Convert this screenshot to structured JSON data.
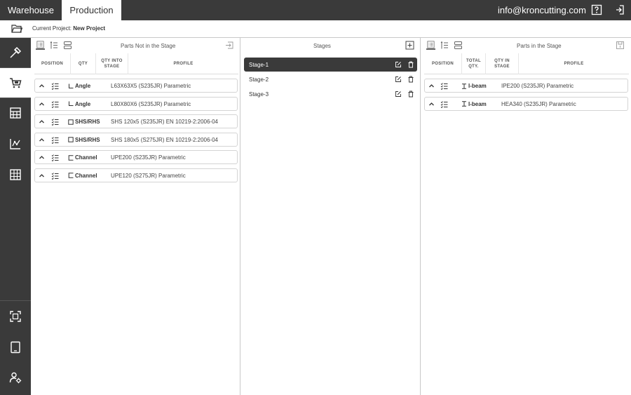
{
  "topbar": {
    "tabs": [
      {
        "label": "Warehouse"
      },
      {
        "label": "Production"
      }
    ],
    "user_email": "info@kroncutting.com",
    "icons": [
      "help-icon",
      "logout-icon"
    ]
  },
  "project": {
    "label": "Current Project:",
    "name": "New Project"
  },
  "sidenav": {
    "items": [
      "cutting-tools-icon",
      "cart-icon",
      "calculator-icon",
      "analytics-icon",
      "table-icon"
    ],
    "bottom_items": [
      "scan-icon",
      "tablet-icon",
      "user-settings-icon"
    ]
  },
  "left_panel": {
    "title": "Parts Not in the Stage",
    "headers": [
      "POSITION",
      "QTY",
      "QTY INTO STAGE",
      "PROFILE"
    ],
    "rows": [
      {
        "type": "Angle",
        "type_icon": "angle-icon",
        "profile": "L63X63X5 (S235JR) Parametric"
      },
      {
        "type": "Angle",
        "type_icon": "angle-icon",
        "profile": "L80X80X6 (S235JR) Parametric"
      },
      {
        "type": "SHS/RHS",
        "type_icon": "square-tube-icon",
        "profile": "SHS 120x5 (S235JR) EN 10219-2:2006-04"
      },
      {
        "type": "SHS/RHS",
        "type_icon": "square-tube-icon",
        "profile": "SHS 180x5 (S275JR) EN 10219-2:2006-04"
      },
      {
        "type": "Channel",
        "type_icon": "channel-icon",
        "profile": "UPE200 (S235JR) Parametric"
      },
      {
        "type": "Channel",
        "type_icon": "channel-icon",
        "profile": "UPE120 (S275JR) Parametric"
      }
    ]
  },
  "mid_panel": {
    "title": "Stages",
    "stages": [
      {
        "name": "Stage-1",
        "selected": true
      },
      {
        "name": "Stage-2",
        "selected": false
      },
      {
        "name": "Stage-3",
        "selected": false
      }
    ]
  },
  "right_panel": {
    "title": "Parts in the Stage",
    "headers": [
      "POSITION",
      "TOTAL QTY.",
      "QTY IN STAGE",
      "PROFILE"
    ],
    "rows": [
      {
        "type": "I-beam",
        "type_icon": "ibeam-icon",
        "profile": "IPE200 (S235JR) Parametric"
      },
      {
        "type": "I-beam",
        "type_icon": "ibeam-icon",
        "profile": "HEA340 (S235JR) Parametric"
      }
    ]
  },
  "colors": {
    "dark": "#3a3a3a",
    "border": "#c8c8c8"
  }
}
